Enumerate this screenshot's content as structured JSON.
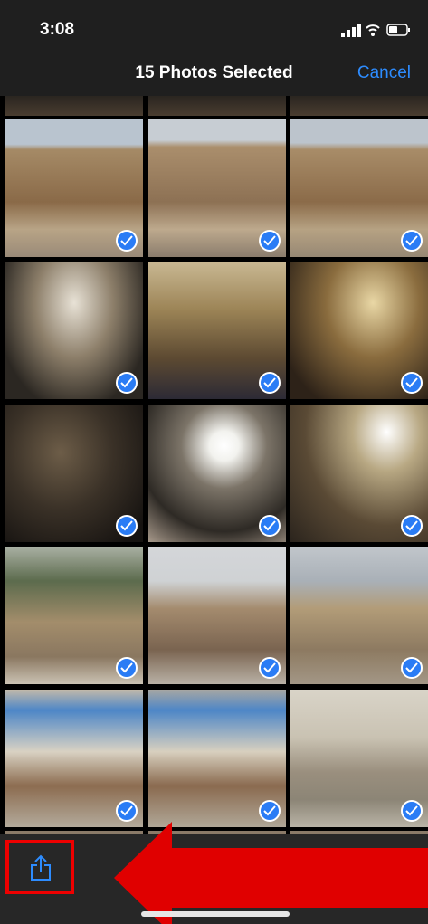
{
  "status_bar": {
    "time": "3:08",
    "icons": [
      "signal-icon",
      "wifi-icon",
      "battery-icon"
    ]
  },
  "nav": {
    "title": "15 Photos Selected",
    "cancel_label": "Cancel"
  },
  "photos": [
    {
      "name": "church-facade-1",
      "selected": true
    },
    {
      "name": "church-facade-2",
      "selected": true
    },
    {
      "name": "church-facade-3",
      "selected": true
    },
    {
      "name": "dome-interior-balconies",
      "selected": true
    },
    {
      "name": "man-in-front-of-altar",
      "selected": true
    },
    {
      "name": "chapel-lamps",
      "selected": true
    },
    {
      "name": "dark-chapel-interior",
      "selected": true
    },
    {
      "name": "rotunda-dome-oculus",
      "selected": true
    },
    {
      "name": "interior-arches",
      "selected": true
    },
    {
      "name": "rooftop-domes",
      "selected": true
    },
    {
      "name": "stone-dome",
      "selected": true
    },
    {
      "name": "courtyard-arches",
      "selected": true
    },
    {
      "name": "mural-wall-1",
      "selected": true
    },
    {
      "name": "mural-wall-2",
      "selected": true
    },
    {
      "name": "stone-columns",
      "selected": true
    }
  ],
  "toolbar": {
    "share_icon": "share-icon",
    "annotation": "red-arrow-pointing-left"
  },
  "colors": {
    "accent": "#2d8cff",
    "check": "#2a7cf5",
    "highlight": "#e00000"
  }
}
